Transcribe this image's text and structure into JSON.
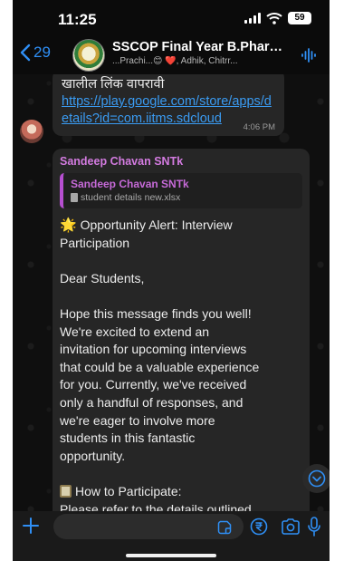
{
  "status_bar": {
    "time": "11:25",
    "battery": "59"
  },
  "header": {
    "back_count": "29",
    "group_name": "SSCOP Final Year B.Pharm...",
    "members_preview": "...Prachi...😊 ❤️, Adhik, Chitrr..."
  },
  "previous_message": {
    "text": "खालील लिंक वापरावी",
    "link": "https://play.google.com/store/apps/details?id=com.iitms.sdcloud",
    "time": "4:06 PM"
  },
  "message": {
    "sender": "Sandeep Chavan SNTk",
    "reply": {
      "sender": "Sandeep Chavan SNTk",
      "file": "student details new.xlsx"
    },
    "spark_icon": "🌟",
    "lines": [
      " Opportunity Alert: Interview",
      "Participation",
      "",
      "Dear Students,",
      "",
      "Hope this message finds you well!",
      "We're excited to extend an",
      "invitation for upcoming interviews",
      "that could be a valuable experience",
      "for you. Currently, we've received",
      "only a handful of responses, and",
      "we're eager to involve more",
      "students in this fantastic",
      "opportunity.",
      "",
      "How to Participate:",
      "Please refer to the details outlined"
    ]
  },
  "colors": {
    "accent": "#2f8ff5",
    "link": "#3a9bf2",
    "sender_name": "#d37be0",
    "bubble": "#262626",
    "background": "#0b0b0b"
  },
  "icons": {
    "back": "chevron-left-icon",
    "voice_call": "audio-waveform-icon",
    "scroll_down": "chevron-down-circle-icon",
    "attach": "plus-icon",
    "sticker": "sticker-icon",
    "payment": "rupee-icon",
    "camera": "camera-icon",
    "mic": "mic-icon"
  }
}
